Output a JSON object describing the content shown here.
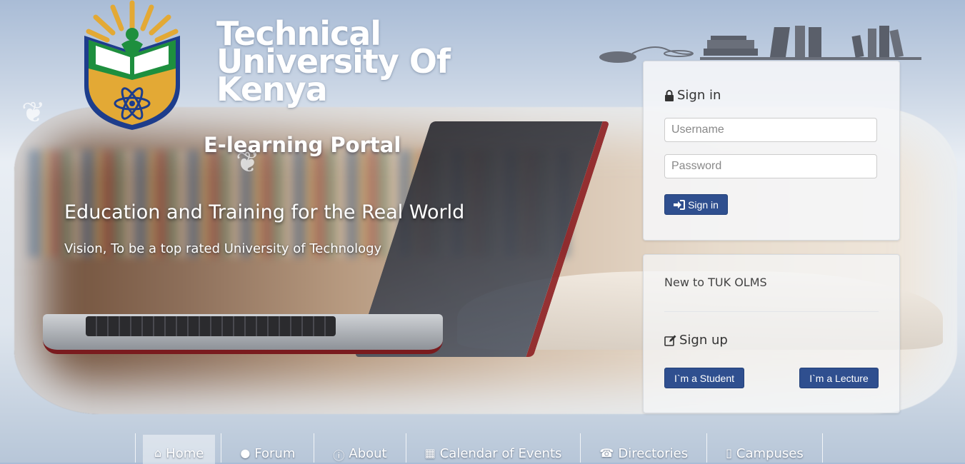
{
  "header": {
    "title": "Technical University Of Kenya",
    "subtitle": "E-learning Portal",
    "slogan": "Education and Training for the Real World",
    "vision": "Vision, To be a top rated University of Technology"
  },
  "signin": {
    "heading": "Sign in",
    "username_placeholder": "Username",
    "password_placeholder": "Password",
    "button_label": "Sign in"
  },
  "signup": {
    "intro": "New to TUK OLMS",
    "heading": "Sign up",
    "student_button": "I`m a Student",
    "lecturer_button": "I`m a Lecture"
  },
  "nav": {
    "items": [
      {
        "label": "Home",
        "icon": "home-icon"
      },
      {
        "label": "Forum",
        "icon": "user-icon"
      },
      {
        "label": "About",
        "icon": "info-icon"
      },
      {
        "label": "Calendar of Events",
        "icon": "calendar-icon"
      },
      {
        "label": "Directories",
        "icon": "phone-icon"
      },
      {
        "label": "Campuses",
        "icon": "building-icon"
      }
    ]
  },
  "colors": {
    "button_blue": "#2f4f8f",
    "logo_green": "#1e8f3e",
    "logo_gold": "#e3a935",
    "logo_blue": "#1d3d8c"
  }
}
